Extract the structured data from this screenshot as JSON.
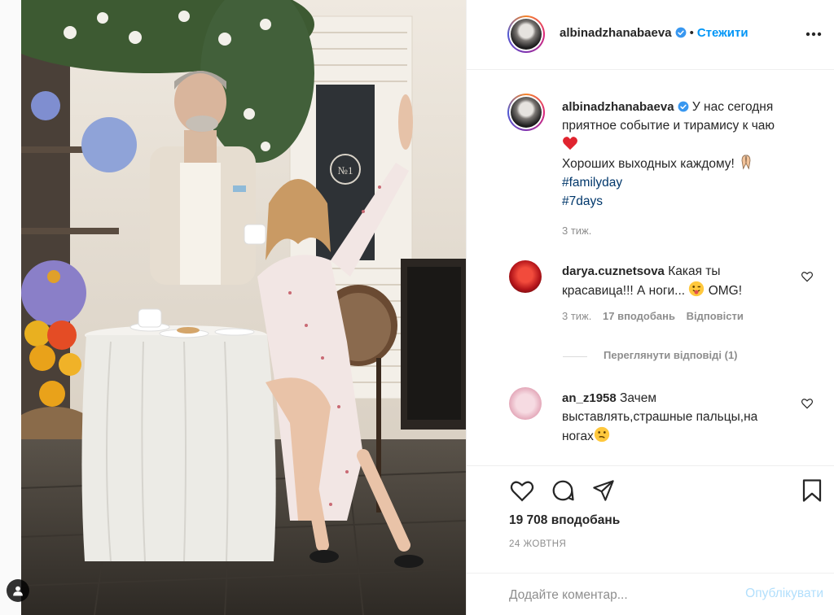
{
  "colors": {
    "accent": "#0095f6",
    "link": "#00376b",
    "muted": "#8e8e8e",
    "border": "#efefef",
    "post_disabled": "#b2dffc",
    "heart_red": "#ed4956"
  },
  "header": {
    "username": "albinadzhanabaeva",
    "separator": "•",
    "follow_label": "Стежити",
    "more_icon": "more-horizontal-icon"
  },
  "caption": {
    "username": "albinadzhanabaeva",
    "text_line1": "У нас сегодня",
    "text_line2": "приятное событие и тирамису к чаю",
    "text_line3": "Хороших выходных каждому!",
    "hashtags": [
      "#familyday",
      "#7days"
    ],
    "time": "3 тиж."
  },
  "comments": [
    {
      "username": "darya.cuznetsova",
      "text_part1": "Какая ты",
      "text_part2": "красавица!!! А ноги...",
      "text_part3": "OMG!",
      "time": "3 тиж.",
      "likes": "17 вподобань",
      "reply": "Відповісти",
      "view_replies": "Переглянути відповіді (1)"
    },
    {
      "username": "an_z1958",
      "text_part1": "Зачем",
      "text_part2": "выставлять,страшные пальцы,на",
      "text_part3": "ногах"
    }
  ],
  "actions": {
    "likes_count": "19 708 вподобань",
    "date": "24 ЖОВТНЯ"
  },
  "add_comment": {
    "placeholder": "Додайте коментар...",
    "post_label": "Опублікувати"
  }
}
